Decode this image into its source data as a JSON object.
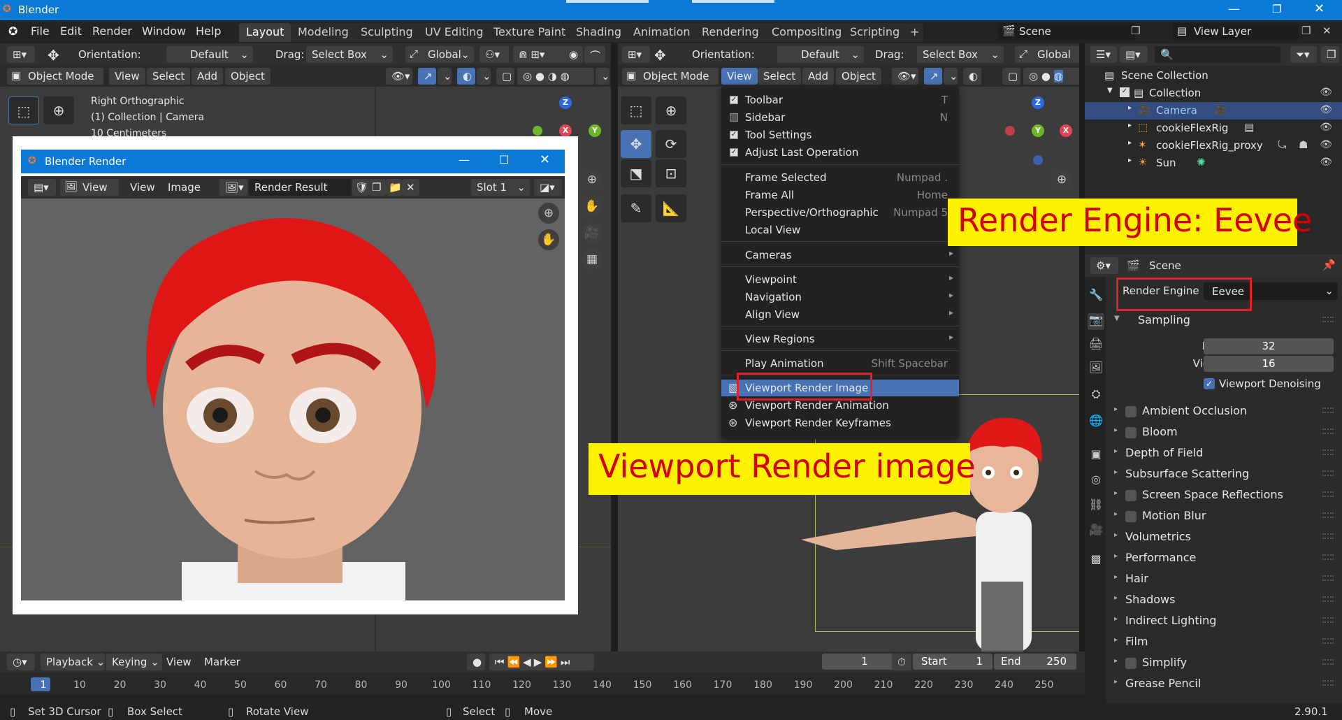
{
  "window": {
    "title": "Blender"
  },
  "menu": [
    "File",
    "Edit",
    "Render",
    "Window",
    "Help"
  ],
  "workspaces": [
    "Layout",
    "Modeling",
    "Sculpting",
    "UV Editing",
    "Texture Paint",
    "Shading",
    "Animation",
    "Rendering",
    "Compositing",
    "Scripting"
  ],
  "scene_field": "Scene",
  "viewlayer_field": "View Layer",
  "left_viewport": {
    "orientation_label": "Orientation:",
    "orientation_value": "Default",
    "drag_label": "Drag:",
    "drag_value": "Select Box",
    "transform": "Global",
    "mode": "Object Mode",
    "menus": [
      "View",
      "Select",
      "Add",
      "Object"
    ],
    "overlay": [
      "Right Orthographic",
      "(1) Collection | Camera",
      "10 Centimeters"
    ]
  },
  "right_viewport": {
    "orientation_label": "Orientation:",
    "orientation_value": "Default",
    "drag_label": "Drag:",
    "drag_value": "Select Box",
    "transform": "Global",
    "mode": "Object Mode",
    "menus": [
      "View",
      "Select",
      "Add",
      "Object"
    ]
  },
  "view_menu": {
    "items": [
      {
        "label": "Toolbar",
        "shortcut": "T",
        "check": true
      },
      {
        "label": "Sidebar",
        "shortcut": "N",
        "check": false
      },
      {
        "label": "Tool Settings",
        "shortcut": "",
        "check": true
      },
      {
        "label": "Adjust Last Operation",
        "shortcut": "",
        "check": true
      },
      {
        "label": "Frame Selected",
        "shortcut": "Numpad ."
      },
      {
        "label": "Frame All",
        "shortcut": "Home"
      },
      {
        "label": "Perspective/Orthographic",
        "shortcut": "Numpad 5"
      },
      {
        "label": "Local View",
        "shortcut": ""
      },
      {
        "label": "Cameras",
        "shortcut": ""
      },
      {
        "label": "Viewpoint",
        "shortcut": ""
      },
      {
        "label": "Navigation",
        "shortcut": ""
      },
      {
        "label": "Align View",
        "shortcut": ""
      },
      {
        "label": "View Regions",
        "shortcut": ""
      },
      {
        "label": "Play Animation",
        "shortcut": "Shift Spacebar"
      },
      {
        "label": "Viewport Render Image",
        "shortcut": ""
      },
      {
        "label": "Viewport Render Animation",
        "shortcut": ""
      },
      {
        "label": "Viewport Render Keyframes",
        "shortcut": ""
      }
    ]
  },
  "outliner": {
    "rows": [
      "Scene Collection",
      "Collection",
      "Camera",
      "cookieFlexRig",
      "cookieFlexRig_proxy",
      "Sun"
    ]
  },
  "properties": {
    "context": "Scene",
    "render_engine_label": "Render Engine",
    "render_engine_value": "Eevee",
    "sampling_label": "Sampling",
    "render_label": "Render",
    "render_samples": "32",
    "viewport_label": "Viewport",
    "viewport_samples": "16",
    "denoising_label": "Viewport Denoising",
    "panels": [
      {
        "label": "Ambient Occlusion",
        "cb": true
      },
      {
        "label": "Bloom",
        "cb": true
      },
      {
        "label": "Depth of Field",
        "cb": false
      },
      {
        "label": "Subsurface Scattering",
        "cb": false
      },
      {
        "label": "Screen Space Reflections",
        "cb": true
      },
      {
        "label": "Motion Blur",
        "cb": true
      },
      {
        "label": "Volumetrics",
        "cb": false
      },
      {
        "label": "Performance",
        "cb": false
      },
      {
        "label": "Hair",
        "cb": false
      },
      {
        "label": "Shadows",
        "cb": false
      },
      {
        "label": "Indirect Lighting",
        "cb": false
      },
      {
        "label": "Film",
        "cb": false
      },
      {
        "label": "Simplify",
        "cb": true
      },
      {
        "label": "Grease Pencil",
        "cb": false
      }
    ]
  },
  "render_window": {
    "title": "Blender Render",
    "view_btn": "View",
    "view_menu": "View",
    "image_menu": "Image",
    "result": "Render Result",
    "slot": "Slot 1"
  },
  "timeline": {
    "playback": "Playback",
    "keying": "Keying",
    "view": "View",
    "marker": "Marker",
    "current_frame": "1",
    "start_label": "Start",
    "start_value": "1",
    "end_label": "End",
    "end_value": "250",
    "ticks": [
      "1",
      "10",
      "20",
      "30",
      "40",
      "50",
      "60",
      "70",
      "80",
      "90",
      "100",
      "110",
      "120",
      "130",
      "140",
      "150",
      "160",
      "170",
      "180",
      "190",
      "200",
      "210",
      "220",
      "230",
      "240",
      "250"
    ]
  },
  "statusbar": {
    "items": [
      "Set 3D Cursor",
      "Box Select",
      "Rotate View",
      "Select",
      "Move"
    ],
    "version": "2.90.1"
  },
  "annotations": {
    "engine": "Render Engine: Eevee",
    "viewport_render": "Viewport Render image"
  }
}
